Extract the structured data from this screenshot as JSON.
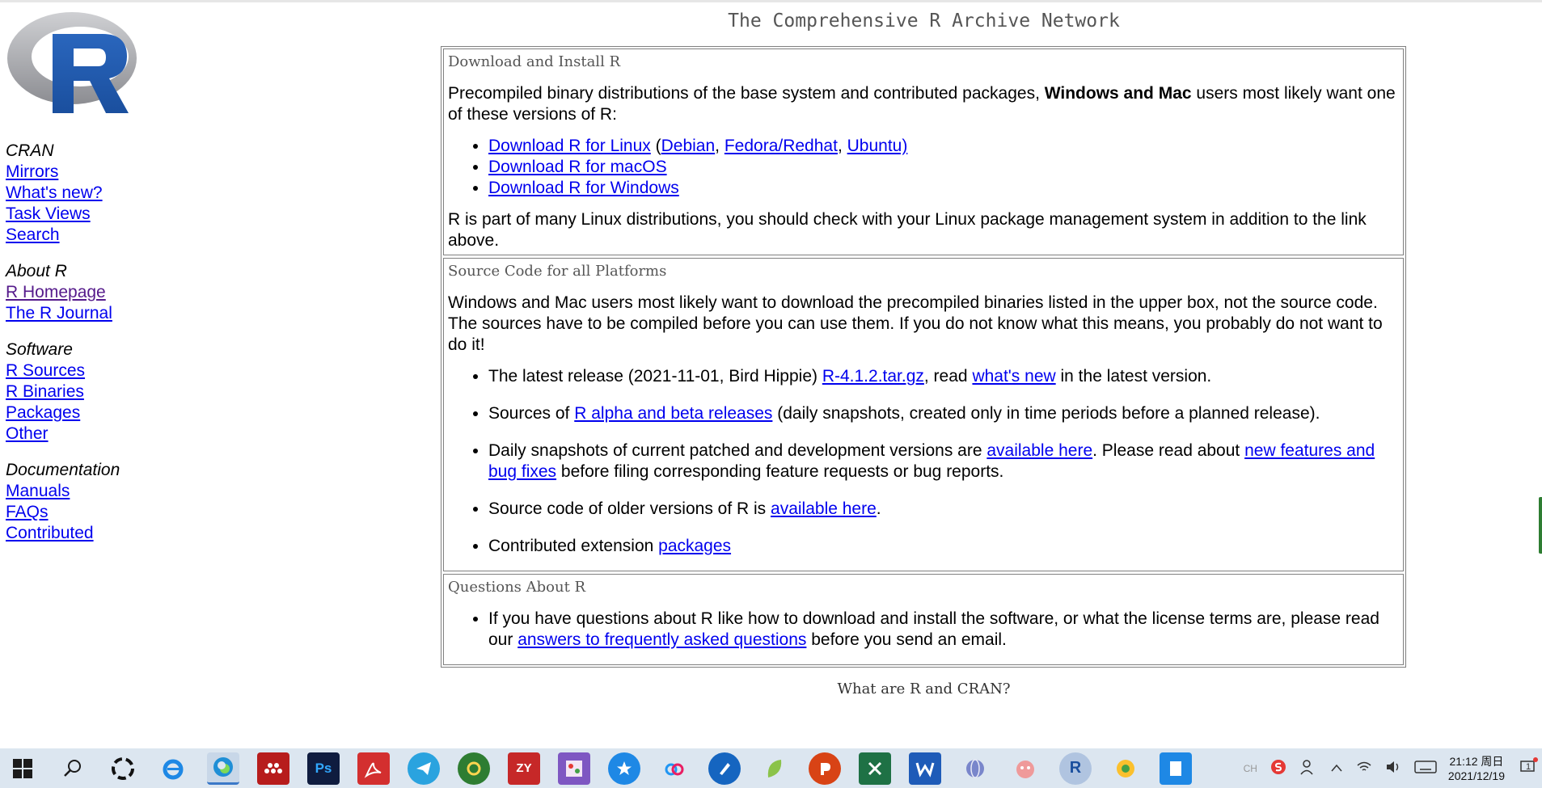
{
  "page": {
    "title": "The Comprehensive R Archive Network",
    "subtitle": "What are R and CRAN?"
  },
  "logo": {
    "letter": "R"
  },
  "sidebar": {
    "groups": [
      {
        "title": "CRAN",
        "links": [
          "Mirrors",
          "What's new?",
          "Task Views",
          "Search"
        ]
      },
      {
        "title": "About R",
        "links": [
          "R Homepage",
          "The R Journal"
        ]
      },
      {
        "title": "Software",
        "links": [
          "R Sources",
          "R Binaries",
          "Packages",
          "Other"
        ]
      },
      {
        "title": "Documentation",
        "links": [
          "Manuals",
          "FAQs",
          "Contributed"
        ]
      }
    ]
  },
  "download": {
    "title": "Download and Install R",
    "intro_a": "Precompiled binary distributions of the base system and contributed packages, ",
    "intro_bold": "Windows and Mac",
    "intro_b": " users most likely want one of these versions of R:",
    "linux_link": "Download R for Linux",
    "open_paren": " (",
    "debian": "Debian",
    "comma1": ", ",
    "fedora": "Fedora/Redhat",
    "comma2": ", ",
    "ubuntu": "Ubuntu)",
    "macos_link": "Download R for macOS",
    "windows_link": "Download R for Windows",
    "outro": "R is part of many Linux distributions, you should check with your Linux package management system in addition to the link above."
  },
  "source": {
    "title": "Source Code for all Platforms",
    "intro": "Windows and Mac users most likely want to download the precompiled binaries listed in the upper box, not the source code. The sources have to be compiled before you can use them. If you do not know what this means, you probably do not want to do it!",
    "latest_a": "The latest release (2021-11-01, Bird Hippie) ",
    "latest_link": "R-4.1.2.tar.gz",
    "latest_b": ", read ",
    "latest_link2": "what's new",
    "latest_c": " in the latest version.",
    "alpha_a": "Sources of ",
    "alpha_link": "R alpha and beta releases",
    "alpha_b": " (daily snapshots, created only in time periods before a planned release).",
    "daily_a": "Daily snapshots of current patched and development versions are ",
    "daily_link": "available here",
    "daily_b": ". Please read about ",
    "daily_link2": "new features and bug fixes",
    "daily_c": " before filing corresponding feature requests or bug reports.",
    "older_a": "Source code of older versions of R is ",
    "older_link": "available here",
    "older_b": ".",
    "contrib_a": "Contributed extension ",
    "contrib_link": "packages"
  },
  "questions": {
    "title": "Questions About R",
    "text_a": "If you have questions about R like how to download and install the software, or what the license terms are, please read our ",
    "link": "answers to frequently asked questions",
    "text_b": " before you send an email."
  },
  "taskbar": {
    "apps": [
      "start-icon",
      "search-icon",
      "ie-icon",
      "edge-icon",
      "mendeley-icon",
      "photoshop-icon",
      "acrobat-icon",
      "telegram-icon",
      "green-app-icon",
      "zotero-icon",
      "paint-icon",
      "star-app-icon",
      "baidu-icon",
      "pen-app-icon",
      "note-icon",
      "powerpoint-icon",
      "excel-icon",
      "word-icon",
      "globe-icon",
      "sogou-icon",
      "r-icon",
      "music-icon",
      "notepad-icon"
    ],
    "labels": {
      "ps": "Ps",
      "zy": "ZY",
      "r": "R"
    },
    "ime": "CH",
    "time": "21:12 周日",
    "date": "2021/12/19",
    "notif": "1"
  }
}
